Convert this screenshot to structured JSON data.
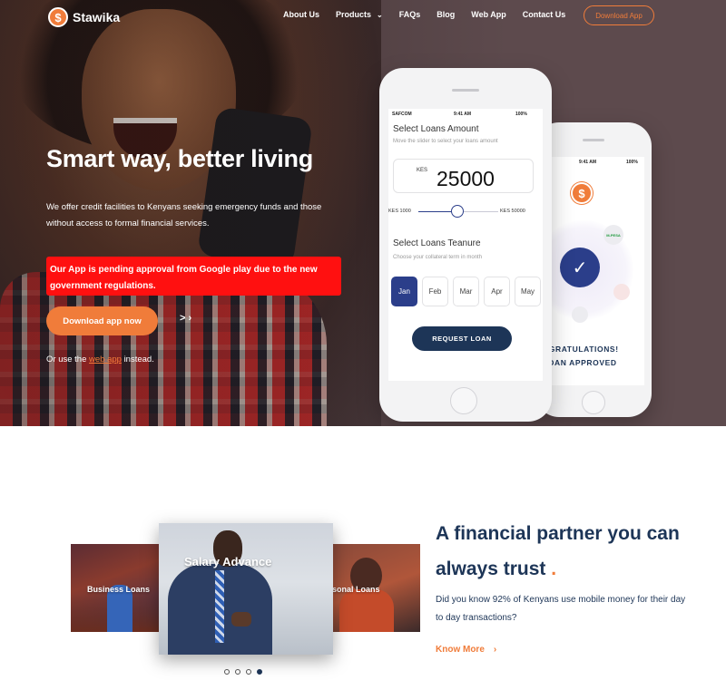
{
  "brand": {
    "name": "Stawika",
    "logo_glyph": "$",
    "accent_color": "#f07c3a",
    "navy_color": "#1d3557"
  },
  "nav": {
    "items": [
      {
        "label": "About Us"
      },
      {
        "label": "Products",
        "dropdown": true
      },
      {
        "label": "FAQs"
      },
      {
        "label": "Blog"
      },
      {
        "label": "Web App"
      },
      {
        "label": "Contact Us"
      }
    ],
    "cta_label": "Download App",
    "chevron_glyph": "⌄"
  },
  "hero": {
    "title": "Smart way, better living",
    "description": "We offer credit facilities to Kenyans seeking emergency funds and those without access to formal financial services.",
    "notice": "Our App is pending approval from Google play due to the new government regulations.",
    "download_label": "Download app now",
    "arrow_label": "> ›",
    "web_app_prefix": "Or use the",
    "web_app_link": "web app",
    "web_app_suffix": "instead."
  },
  "phone_front": {
    "carrier": "SAFCOM",
    "time": "9:41 AM",
    "battery": "100%",
    "amount_title": "Select Loans Amount",
    "amount_subtitle": "Move the slider to select your loans amount",
    "currency": "KES",
    "amount": "25000",
    "slider_min": "KES 1000",
    "slider_max": "KES 50000",
    "slider_fraction": 0.49,
    "tenure_title": "Select Loans Teanure",
    "tenure_subtitle": "Choose your collateral term in month",
    "months": [
      {
        "label": "Jan",
        "active": true
      },
      {
        "label": "Feb",
        "active": false
      },
      {
        "label": "Mar",
        "active": false
      },
      {
        "label": "Apr",
        "active": false
      },
      {
        "label": "May",
        "active": false
      }
    ],
    "request_label": "REQUEST LOAN"
  },
  "phone_back": {
    "time": "9:41 AM",
    "battery": "100%",
    "app_logo_glyph": "$",
    "check_glyph": "✓",
    "mpesa_label": "M-PESA",
    "congrats_line1": "NGRATULATIONS!",
    "congrats_line2": "LOAN APPROVED"
  },
  "carousel": {
    "slides": [
      {
        "label": "Business Loans"
      },
      {
        "label": "Salary Advance"
      },
      {
        "label": "sonal Loans"
      }
    ],
    "dots": [
      false,
      false,
      false,
      true
    ]
  },
  "trust": {
    "title_line1": "A financial partner you can",
    "title_line2": "always trust",
    "title_dot": ".",
    "text": "Did you know 92% of Kenyans use mobile money for their day to day transactions?",
    "cta_label": "Know More",
    "cta_chevron": "›"
  }
}
